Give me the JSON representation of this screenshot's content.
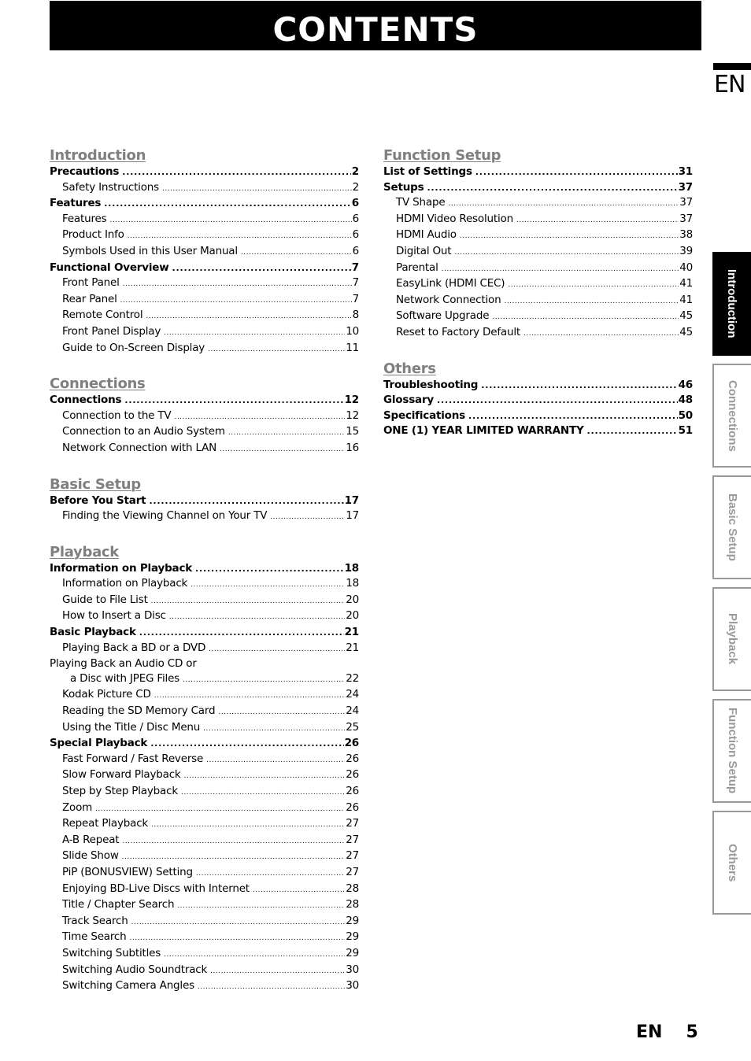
{
  "header": {
    "title": "CONTENTS",
    "language_mark": "EN"
  },
  "columns": {
    "left": [
      {
        "title": "Introduction",
        "entries": [
          {
            "level": "main",
            "label": "Precautions",
            "page": "2"
          },
          {
            "level": "sub",
            "label": "Safety Instructions",
            "page": "2"
          },
          {
            "level": "main",
            "label": "Features",
            "page": "6"
          },
          {
            "level": "sub",
            "label": "Features",
            "page": "6"
          },
          {
            "level": "sub",
            "label": "Product Info",
            "page": "6"
          },
          {
            "level": "sub",
            "label": "Symbols Used in this User Manual",
            "page": "6"
          },
          {
            "level": "main",
            "label": "Functional Overview",
            "page": "7"
          },
          {
            "level": "sub",
            "label": "Front Panel",
            "page": "7"
          },
          {
            "level": "sub",
            "label": "Rear Panel",
            "page": "7"
          },
          {
            "level": "sub",
            "label": "Remote Control",
            "page": "8"
          },
          {
            "level": "sub",
            "label": "Front Panel Display",
            "page": "10"
          },
          {
            "level": "sub",
            "label": "Guide to On-Screen Display",
            "page": "11"
          }
        ]
      },
      {
        "title": "Connections",
        "entries": [
          {
            "level": "main",
            "label": "Connections",
            "page": "12"
          },
          {
            "level": "sub",
            "label": "Connection to the TV",
            "page": "12"
          },
          {
            "level": "sub",
            "label": "Connection to an Audio System",
            "page": "15"
          },
          {
            "level": "sub",
            "label": "Network Connection with LAN",
            "page": "16"
          }
        ]
      },
      {
        "title": "Basic Setup",
        "entries": [
          {
            "level": "main",
            "label": "Before You Start",
            "page": "17"
          },
          {
            "level": "sub",
            "label": "Finding the Viewing Channel on Your TV",
            "page": "17"
          }
        ]
      },
      {
        "title": "Playback",
        "entries": [
          {
            "level": "main",
            "label": "Information on Playback",
            "page": "18"
          },
          {
            "level": "sub",
            "label": "Information on Playback",
            "page": "18"
          },
          {
            "level": "sub",
            "label": "Guide to File List",
            "page": "20"
          },
          {
            "level": "sub",
            "label": "How to Insert a Disc",
            "page": "20"
          },
          {
            "level": "main",
            "label": "Basic Playback",
            "page": "21"
          },
          {
            "level": "sub",
            "label": "Playing Back a BD or a DVD",
            "page": "21"
          },
          {
            "level": "cont",
            "label": "Playing Back an Audio CD or",
            "page": ""
          },
          {
            "level": "sub2",
            "label": "a Disc with JPEG Files",
            "page": "22"
          },
          {
            "level": "sub",
            "label": "Kodak Picture CD",
            "page": "24"
          },
          {
            "level": "sub",
            "label": "Reading the SD Memory Card",
            "page": "24"
          },
          {
            "level": "sub",
            "label": "Using the Title / Disc Menu",
            "page": "25"
          },
          {
            "level": "main",
            "label": "Special Playback",
            "page": "26"
          },
          {
            "level": "sub",
            "label": "Fast Forward / Fast Reverse",
            "page": "26"
          },
          {
            "level": "sub",
            "label": "Slow Forward Playback",
            "page": "26"
          },
          {
            "level": "sub",
            "label": "Step by Step Playback",
            "page": "26"
          },
          {
            "level": "sub",
            "label": "Zoom",
            "page": "26"
          },
          {
            "level": "sub",
            "label": "Repeat Playback",
            "page": "27"
          },
          {
            "level": "sub",
            "label": "A-B Repeat",
            "page": "27"
          },
          {
            "level": "sub",
            "label": "Slide Show",
            "page": "27"
          },
          {
            "level": "sub",
            "label": "PiP (BONUSVIEW) Setting",
            "page": "27"
          },
          {
            "level": "sub",
            "label": "Enjoying BD-Live Discs with Internet",
            "page": "28"
          },
          {
            "level": "sub",
            "label": "Title / Chapter Search",
            "page": "28"
          },
          {
            "level": "sub",
            "label": "Track Search",
            "page": "29"
          },
          {
            "level": "sub",
            "label": "Time Search",
            "page": "29"
          },
          {
            "level": "sub",
            "label": "Switching Subtitles",
            "page": "29"
          },
          {
            "level": "sub",
            "label": "Switching Audio Soundtrack",
            "page": "30"
          },
          {
            "level": "sub",
            "label": "Switching Camera Angles",
            "page": "30"
          }
        ]
      }
    ],
    "right": [
      {
        "title": "Function Setup",
        "entries": [
          {
            "level": "main",
            "label": "List of Settings",
            "page": "31"
          },
          {
            "level": "main",
            "label": "Setups",
            "page": "37"
          },
          {
            "level": "sub",
            "label": "TV Shape",
            "page": "37"
          },
          {
            "level": "sub",
            "label": "HDMI Video Resolution",
            "page": "37"
          },
          {
            "level": "sub",
            "label": "HDMI Audio",
            "page": "38"
          },
          {
            "level": "sub",
            "label": "Digital Out",
            "page": "39"
          },
          {
            "level": "sub",
            "label": "Parental",
            "page": "40"
          },
          {
            "level": "sub",
            "label": "EasyLink (HDMI CEC)",
            "page": "41"
          },
          {
            "level": "sub",
            "label": "Network Connection",
            "page": "41"
          },
          {
            "level": "sub",
            "label": "Software Upgrade",
            "page": "45"
          },
          {
            "level": "sub",
            "label": "Reset to Factory Default",
            "page": "45"
          }
        ]
      },
      {
        "title": "Others",
        "entries": [
          {
            "level": "main",
            "label": "Troubleshooting",
            "page": "46"
          },
          {
            "level": "main",
            "label": "Glossary",
            "page": "48"
          },
          {
            "level": "main",
            "label": "Specifications",
            "page": "50"
          },
          {
            "level": "main",
            "label": "ONE (1) YEAR LIMITED WARRANTY",
            "page": "51"
          }
        ]
      }
    ]
  },
  "side_tabs": [
    {
      "label": "Introduction",
      "active": true
    },
    {
      "label": "Connections",
      "active": false
    },
    {
      "label": "Basic Setup",
      "active": false
    },
    {
      "label": "Playback",
      "active": false
    },
    {
      "label": "Function Setup",
      "active": false
    },
    {
      "label": "Others",
      "active": false
    }
  ],
  "footer": {
    "language": "EN",
    "page_number": "5"
  },
  "colors": {
    "section_heading": "#808080",
    "tab_active_bg": "#000000",
    "tab_inactive_text": "#9a9a9a"
  }
}
